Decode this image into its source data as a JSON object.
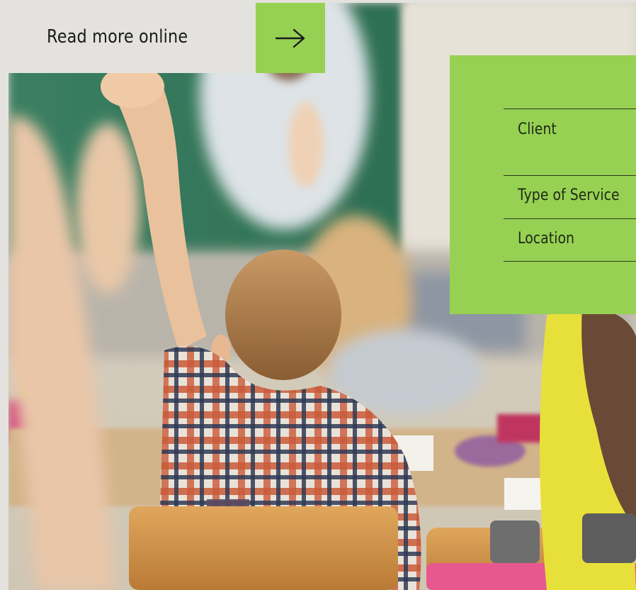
{
  "read_more": {
    "label": "Read more online",
    "arrow_icon": "arrow-right-icon"
  },
  "project_info": {
    "rows": [
      {
        "label": "Client"
      },
      {
        "label": "Type of Service"
      },
      {
        "label": "Location"
      }
    ]
  },
  "photo": {
    "subject": "classroom-students-raising-hands"
  },
  "colors": {
    "accent_green": "#97d153",
    "background": "#e3e2de",
    "text": "#1a1a1a",
    "rule": "#2a3a1c"
  }
}
